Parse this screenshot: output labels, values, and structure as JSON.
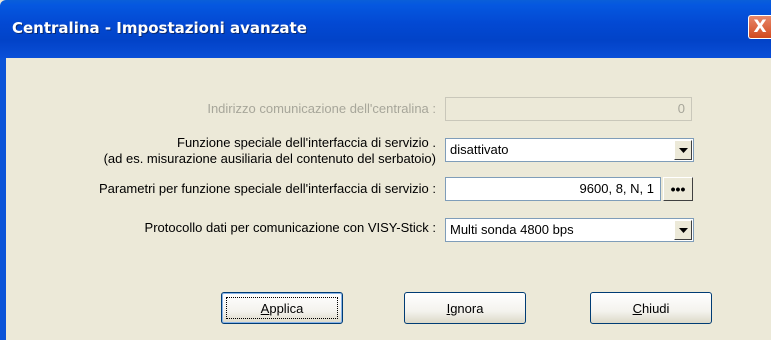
{
  "window": {
    "title": "Centralina - Impostazioni avanzate",
    "close_glyph": "X"
  },
  "fields": {
    "address": {
      "label": "Indirizzo comunicazione dell'centralina :",
      "value": "0"
    },
    "special_function": {
      "label_line1": "Funzione speciale dell'interfaccia di servizio .",
      "label_line2": "(ad es. misurazione ausiliaria del contenuto del serbatoio)",
      "value": "disattivato"
    },
    "special_params": {
      "label": "Parametri per funzione speciale dell'interfaccia di servizio :",
      "value": "9600, 8, N, 1",
      "button_label": "•••"
    },
    "protocol": {
      "label": "Protocollo dati per comunicazione con VISY-Stick :",
      "value": "Multi sonda 4800 bps"
    }
  },
  "buttons": {
    "apply": {
      "underlined": "A",
      "rest": "pplica"
    },
    "ignore": {
      "underlined": "I",
      "rest": "gnora"
    },
    "close": {
      "underlined": "C",
      "rest": "hiudi"
    }
  },
  "icons": {
    "dropdown": "chevron-down-icon",
    "close": "close-icon",
    "more": "ellipsis-icon"
  }
}
